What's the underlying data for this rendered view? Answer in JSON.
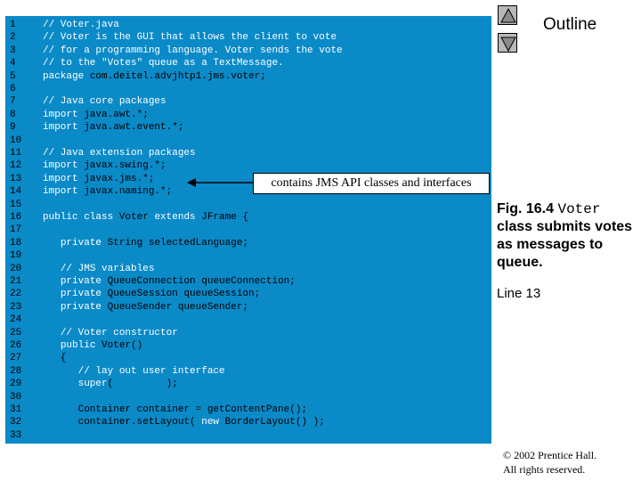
{
  "nav": {
    "up_icon": "triangle-up-icon",
    "down_icon": "triangle-down-icon"
  },
  "outline_label": "Outline",
  "callout": "contains JMS API classes and interfaces",
  "caption": {
    "fig_prefix": "Fig. 16.4 ",
    "class_name": "Voter",
    "fig_suffix": " class submits votes as messages to queue.",
    "line_ref": "Line 13"
  },
  "copyright": {
    "line1": "© 2002 Prentice Hall.",
    "line2": "All rights reserved."
  },
  "colors": {
    "panel": "#0b8ac8",
    "comment": "#ffffff",
    "keyword": "#ffffff",
    "text": "#000000"
  },
  "code_lines": [
    {
      "n": "1",
      "segs": [
        [
          "c",
          "// Voter.java"
        ]
      ]
    },
    {
      "n": "2",
      "segs": [
        [
          "c",
          "// Voter is the GUI that allows the client to vote"
        ]
      ]
    },
    {
      "n": "3",
      "segs": [
        [
          "c",
          "// for a programming language. Voter sends the vote"
        ]
      ]
    },
    {
      "n": "4",
      "segs": [
        [
          "c",
          "// to the \"Votes\" queue as a TextMessage."
        ]
      ]
    },
    {
      "n": "5",
      "segs": [
        [
          "k",
          "package"
        ],
        [
          "t",
          " com.deitel.advjhtp1.jms.voter;"
        ]
      ]
    },
    {
      "n": "6",
      "segs": []
    },
    {
      "n": "7",
      "segs": [
        [
          "c",
          "// Java core packages"
        ]
      ]
    },
    {
      "n": "8",
      "segs": [
        [
          "k",
          "import"
        ],
        [
          "t",
          " java.awt.*;"
        ]
      ]
    },
    {
      "n": "9",
      "segs": [
        [
          "k",
          "import"
        ],
        [
          "t",
          " java.awt.event.*;"
        ]
      ]
    },
    {
      "n": "10",
      "segs": []
    },
    {
      "n": "11",
      "segs": [
        [
          "c",
          "// Java extension packages"
        ]
      ]
    },
    {
      "n": "12",
      "segs": [
        [
          "k",
          "import"
        ],
        [
          "t",
          " javax.swing.*;"
        ]
      ]
    },
    {
      "n": "13",
      "segs": [
        [
          "k",
          "import"
        ],
        [
          "t",
          " javax.jms.*;"
        ]
      ]
    },
    {
      "n": "14",
      "segs": [
        [
          "k",
          "import"
        ],
        [
          "t",
          " javax.naming.*;"
        ]
      ]
    },
    {
      "n": "15",
      "segs": []
    },
    {
      "n": "16",
      "segs": [
        [
          "k",
          "public class"
        ],
        [
          "t",
          " Voter "
        ],
        [
          "k",
          "extends"
        ],
        [
          "t",
          " JFrame {"
        ]
      ]
    },
    {
      "n": "17",
      "segs": []
    },
    {
      "n": "18",
      "segs": [
        [
          "t",
          "   "
        ],
        [
          "k",
          "private"
        ],
        [
          "t",
          " String selectedLanguage;"
        ]
      ]
    },
    {
      "n": "19",
      "segs": []
    },
    {
      "n": "20",
      "segs": [
        [
          "t",
          "   "
        ],
        [
          "c",
          "// JMS variables"
        ]
      ]
    },
    {
      "n": "21",
      "segs": [
        [
          "t",
          "   "
        ],
        [
          "k",
          "private"
        ],
        [
          "t",
          " QueueConnection queueConnection;"
        ]
      ]
    },
    {
      "n": "22",
      "segs": [
        [
          "t",
          "   "
        ],
        [
          "k",
          "private"
        ],
        [
          "t",
          " QueueSession queueSession;"
        ]
      ]
    },
    {
      "n": "23",
      "segs": [
        [
          "t",
          "   "
        ],
        [
          "k",
          "private"
        ],
        [
          "t",
          " QueueSender queueSender;"
        ]
      ]
    },
    {
      "n": "24",
      "segs": []
    },
    {
      "n": "25",
      "segs": [
        [
          "t",
          "   "
        ],
        [
          "c",
          "// Voter constructor"
        ]
      ]
    },
    {
      "n": "26",
      "segs": [
        [
          "t",
          "   "
        ],
        [
          "k",
          "public"
        ],
        [
          "t",
          " Voter()"
        ]
      ]
    },
    {
      "n": "27",
      "segs": [
        [
          "t",
          "   {"
        ]
      ]
    },
    {
      "n": "28",
      "segs": [
        [
          "t",
          "      "
        ],
        [
          "c",
          "// lay out user interface"
        ]
      ]
    },
    {
      "n": "29",
      "segs": [
        [
          "t",
          "      "
        ],
        [
          "k",
          "super"
        ],
        [
          "t",
          "(         );"
        ]
      ]
    },
    {
      "n": "30",
      "segs": []
    },
    {
      "n": "31",
      "segs": [
        [
          "t",
          "      Container container = getContentPane();"
        ]
      ]
    },
    {
      "n": "32",
      "segs": [
        [
          "t",
          "      container.setLayout( "
        ],
        [
          "k",
          "new"
        ],
        [
          "t",
          " BorderLayout() );"
        ]
      ]
    },
    {
      "n": "33",
      "segs": []
    }
  ]
}
